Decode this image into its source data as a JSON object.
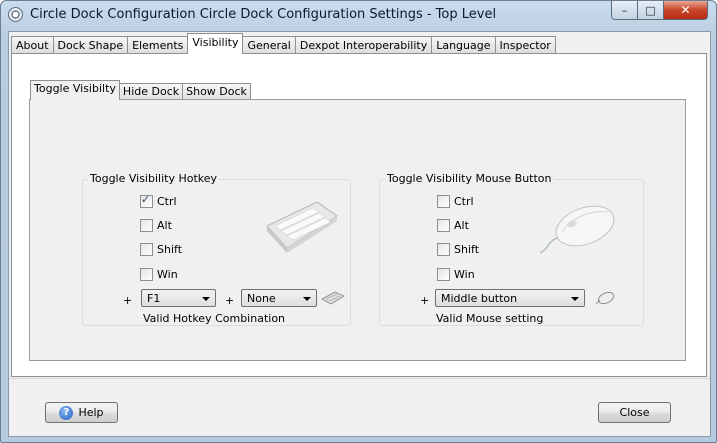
{
  "window": {
    "title": "Circle Dock Configuration Circle Dock Configuration Settings - Top Level",
    "minimize_glyph": "–",
    "maximize_glyph": "□",
    "close_glyph": "✕"
  },
  "tabs": [
    "About",
    "Dock Shape",
    "Elements",
    "Visibility",
    "General",
    "Dexpot Interoperability",
    "Language",
    "Inspector"
  ],
  "active_tab": "Visibility",
  "subtabs": [
    "Toggle Visibilty",
    "Hide Dock",
    "Show Dock"
  ],
  "active_subtab": "Toggle Visibilty",
  "hotkey_group": {
    "title": "Toggle Visibility Hotkey",
    "modifiers": [
      {
        "label": "Ctrl",
        "checked": true
      },
      {
        "label": "Alt",
        "checked": false
      },
      {
        "label": "Shift",
        "checked": false
      },
      {
        "label": "Win",
        "checked": false
      }
    ],
    "plus": "+",
    "key1": "F1",
    "key2": "None",
    "status": "Valid Hotkey Combination"
  },
  "mouse_group": {
    "title": "Toggle Visibility Mouse Button",
    "modifiers": [
      {
        "label": "Ctrl",
        "checked": false
      },
      {
        "label": "Alt",
        "checked": false
      },
      {
        "label": "Shift",
        "checked": false
      },
      {
        "label": "Win",
        "checked": false
      }
    ],
    "plus": "+",
    "button": "Middle button",
    "status": "Valid Mouse setting"
  },
  "footer": {
    "help_label": "Help",
    "help_icon_glyph": "?",
    "close_label": "Close"
  }
}
